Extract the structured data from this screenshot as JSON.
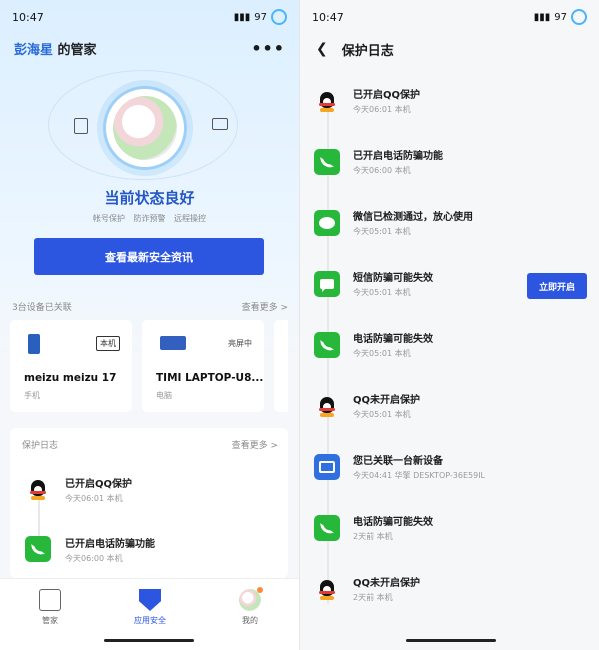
{
  "left": {
    "status": {
      "time": "10:47",
      "battery": "97"
    },
    "header": {
      "owner": "彭海星",
      "suffix": " 的管家",
      "more": "•••"
    },
    "state_title": "当前状态良好",
    "state_tags": [
      "帐号保护",
      "防诈预警",
      "远程操控"
    ],
    "primary_button": "查看最新安全资讯",
    "devices_section": {
      "title": "3台设备已关联",
      "more": "查看更多 >"
    },
    "devices": [
      {
        "name": "meizu meizu 17",
        "type": "手机",
        "tag": "本机"
      },
      {
        "name": "TIMI LAPTOP-U8...",
        "type": "电脑",
        "tag": "亮屏中"
      }
    ],
    "log_section": {
      "title": "保护日志",
      "more": "查看更多 >"
    },
    "logs": [
      {
        "title": "已开启QQ保护",
        "meta": "今天06:01 本机"
      },
      {
        "title": "已开启电话防骗功能",
        "meta": "今天06:00 本机"
      }
    ],
    "nav": [
      {
        "label": "管家"
      },
      {
        "label": "应用安全"
      },
      {
        "label": "我的"
      }
    ]
  },
  "right": {
    "status": {
      "time": "10:47",
      "battery": "97"
    },
    "title": "保护日志",
    "enable_button": "立即开启",
    "logs": [
      {
        "title": "已开启QQ保护",
        "meta": "今天06:01 本机",
        "icon": "qq-icon"
      },
      {
        "title": "已开启电话防骗功能",
        "meta": "今天06:00 本机",
        "icon": "phone-icon"
      },
      {
        "title": "微信已检测通过，放心使用",
        "meta": "今天05:01 本机",
        "icon": "wechat-icon"
      },
      {
        "title": "短信防骗可能失效",
        "meta": "今天05:01 本机",
        "icon": "sms-icon"
      },
      {
        "title": "电话防骗可能失效",
        "meta": "今天05:01 本机",
        "icon": "phone-icon"
      },
      {
        "title": "QQ未开启保护",
        "meta": "今天05:01 本机",
        "icon": "qq-icon"
      },
      {
        "title": "您已关联一台新设备",
        "meta": "今天04:41 华擎 DESKTOP-36E59IL",
        "icon": "device-icon"
      },
      {
        "title": "电话防骗可能失效",
        "meta": "2天前 本机",
        "icon": "phone-icon"
      },
      {
        "title": "QQ未开启保护",
        "meta": "2天前 本机",
        "icon": "qq-icon"
      }
    ]
  },
  "colors": {
    "primary": "#2c55e0",
    "green": "#27b83b",
    "blue": "#2f6fe0",
    "state": "#2457c5"
  }
}
